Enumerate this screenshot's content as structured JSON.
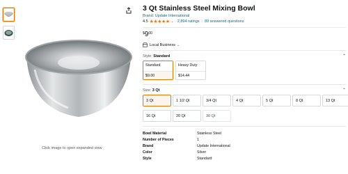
{
  "product": {
    "title": "3 Qt Stainless Steel Mixing Bowl",
    "brand_link": "Brand: Update International",
    "rating_value": "4.5",
    "ratings_count": "2,894 ratings",
    "answered": "89 answered questions",
    "price": {
      "currency": "$",
      "whole": "9",
      "fraction": "00"
    },
    "local_business": "Local Business"
  },
  "gallery": {
    "caption": "Click image to open expanded view",
    "thumbnails": [
      "bowl-front",
      "bowl-top"
    ]
  },
  "style": {
    "label": "Style:",
    "selected": "Standard",
    "options": [
      {
        "name": "Standard",
        "price": "$9.00"
      },
      {
        "name": "Heavy Duty",
        "price": "$14.44"
      }
    ]
  },
  "size": {
    "label": "Size:",
    "selected": "3 Qt",
    "options": [
      "3 Qt",
      "1 1/2 Qt",
      "3/4 Qt",
      "4 Qt",
      "5 Qt",
      "8 Qt",
      "13 Qt",
      "16 Qt",
      "20 Qt",
      "30 Qt"
    ]
  },
  "specs": [
    {
      "key": "Bowl Material",
      "value": "Stainless Steel"
    },
    {
      "key": "Number of Pieces",
      "value": "1"
    },
    {
      "key": "Brand",
      "value": "Update International"
    },
    {
      "key": "Color",
      "value": "Silver"
    },
    {
      "key": "Style",
      "value": "Standard"
    }
  ],
  "colors": {
    "accent": "#e77600",
    "link": "#007185",
    "star": "#de7921"
  }
}
